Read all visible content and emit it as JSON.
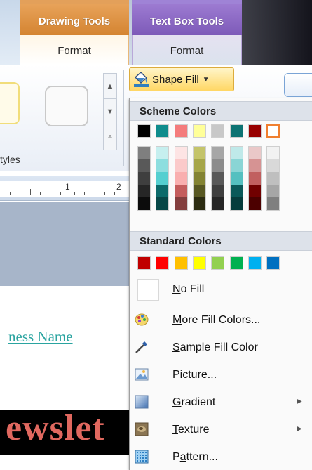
{
  "ribbon": {
    "contextual_tabs": [
      {
        "group": "Drawing Tools",
        "tab": "Format",
        "color": "#e3a05a"
      },
      {
        "group": "Text Box Tools",
        "tab": "Format",
        "color": "#8f6fc7"
      }
    ],
    "gallery_group_label": "tyles",
    "shape_fill_label": "Shape Fill"
  },
  "ruler": {
    "labels": [
      "1",
      "2"
    ]
  },
  "document": {
    "business_name": "ness Name",
    "newsletter": "ewslet"
  },
  "menu": {
    "scheme_colors_header": "Scheme Colors",
    "standard_colors_header": "Standard Colors",
    "scheme_top": [
      "#000000",
      "#0f8c8c",
      "#f47c7c",
      "#ffff99",
      "#c8c8c8",
      "#0d7373",
      "#980000",
      "#ffffff"
    ],
    "scheme_shades": [
      [
        "#7f7f7f",
        "#595959",
        "#3f3f3f",
        "#262626",
        "#0c0c0c"
      ],
      [
        "#c6efef",
        "#8ddedf",
        "#54cfd0",
        "#0b6a6a",
        "#064747"
      ],
      [
        "#fde4e4",
        "#fbcaca",
        "#f9afaf",
        "#c45d5d",
        "#833e3e"
      ],
      [
        "#c4c46a",
        "#a6a649",
        "#838333",
        "#575722",
        "#2b2b11"
      ],
      [
        "#a6a6a6",
        "#8c8c8c",
        "#595959",
        "#3f3f3f",
        "#262626"
      ],
      [
        "#bfe9e9",
        "#8ad5d5",
        "#55c0c0",
        "#0a5959",
        "#063c3c"
      ],
      [
        "#eac8c8",
        "#d69393",
        "#c15f5f",
        "#710000",
        "#4c0000"
      ],
      [
        "#f2f2f2",
        "#d9d9d9",
        "#bfbfbf",
        "#a6a6a6",
        "#7f7f7f"
      ]
    ],
    "standard_colors": [
      "#c00000",
      "#ff0000",
      "#ffc000",
      "#ffff00",
      "#92d050",
      "#00b050",
      "#00b0f0",
      "#0070c0"
    ],
    "items": [
      {
        "label": "No Fill",
        "accel": "N",
        "icon": "no-fill-icon"
      },
      {
        "label": "More Fill Colors...",
        "accel": "M",
        "icon": "palette-icon"
      },
      {
        "label": "Sample Fill Color",
        "accel": "S",
        "icon": "eyedropper-icon"
      },
      {
        "label": "Picture...",
        "accel": "P",
        "icon": "picture-icon"
      },
      {
        "label": "Gradient",
        "accel": "G",
        "icon": "gradient-icon",
        "submenu": true
      },
      {
        "label": "Texture",
        "accel": "T",
        "icon": "texture-icon",
        "submenu": true
      },
      {
        "label": "Pattern...",
        "accel": "a",
        "icon": "pattern-icon"
      }
    ]
  }
}
